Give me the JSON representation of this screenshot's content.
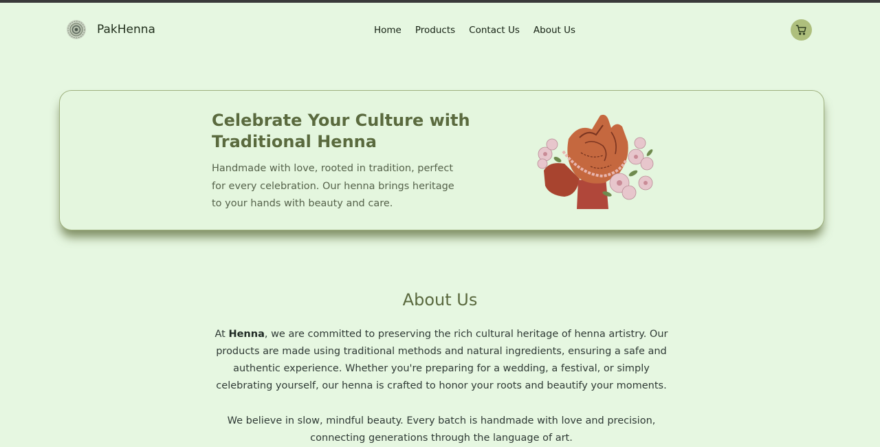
{
  "brand": {
    "name": "PakHenna",
    "logo_icon": "mandala-logo-icon"
  },
  "nav": {
    "items": [
      "Home",
      "Products",
      "Contact Us",
      "About Us"
    ]
  },
  "header": {
    "cart_icon": "shopping-cart-icon",
    "cart_color": "#aebf7d"
  },
  "hero": {
    "title": "Celebrate Your Culture with Traditional Henna",
    "text": "Handmade with love, rooted in tradition, perfect for every celebration. Our henna brings heritage to your hands with beauty and care.",
    "image": "henna-hands-flowers-illustration"
  },
  "about": {
    "title": "About Us",
    "p1_prefix": "At ",
    "p1_bold": "Henna",
    "p1_rest": ", we are committed to preserving the rich cultural heritage of henna artistry. Our products are made using traditional methods and natural ingredients, ensuring a safe and authentic experience. Whether you're preparing for a wedding, a festival, or simply celebrating yourself, our henna is crafted to honor your roots and beautify your moments.",
    "p2": "We believe in slow, mindful beauty. Every batch is handmade with love and precision, connecting generations through the language of art."
  },
  "colors": {
    "background": "#e6f7e1",
    "accent": "#5a6a3e"
  }
}
